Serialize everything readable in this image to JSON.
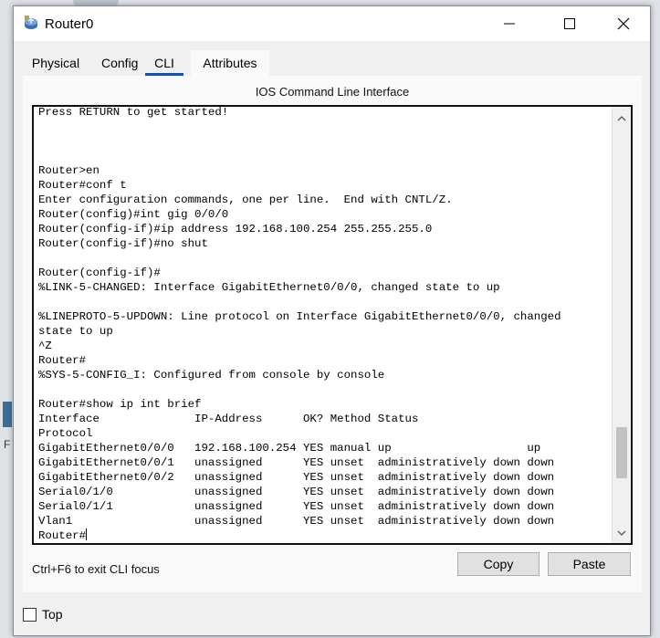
{
  "window": {
    "title": "Router0",
    "icon": "router-icon",
    "controls": [
      "minimize-icon",
      "maximize-icon",
      "close-icon"
    ]
  },
  "tabs": [
    {
      "label": "Physical"
    },
    {
      "label": "Config"
    },
    {
      "label": "CLI",
      "active": true
    },
    {
      "label": "Attributes"
    }
  ],
  "cli": {
    "header": "IOS Command Line Interface",
    "lines": [
      "Press RETURN to get started!",
      "",
      "",
      "",
      "Router>en",
      "Router#conf t",
      "Enter configuration commands, one per line.  End with CNTL/Z.",
      "Router(config)#int gig 0/0/0",
      "Router(config-if)#ip address 192.168.100.254 255.255.255.0",
      "Router(config-if)#no shut",
      "",
      "Router(config-if)#",
      "%LINK-5-CHANGED: Interface GigabitEthernet0/0/0, changed state to up",
      "",
      "%LINEPROTO-5-UPDOWN: Line protocol on Interface GigabitEthernet0/0/0, changed",
      "state to up",
      "^Z",
      "Router#",
      "%SYS-5-CONFIG_I: Configured from console by console",
      "",
      "Router#show ip int brief",
      "Interface              IP-Address      OK? Method Status",
      "Protocol",
      "GigabitEthernet0/0/0   192.168.100.254 YES manual up                    up",
      "GigabitEthernet0/0/1   unassigned      YES unset  administratively down down",
      "GigabitEthernet0/0/2   unassigned      YES unset  administratively down down",
      "Serial0/1/0            unassigned      YES unset  administratively down down",
      "Serial0/1/1            unassigned      YES unset  administratively down down",
      "Vlan1                  unassigned      YES unset  administratively down down"
    ],
    "prompt": "Router#",
    "scroll_position": 0.87
  },
  "footer": {
    "hint": "Ctrl+F6 to exit CLI focus",
    "copy_label": "Copy",
    "paste_label": "Paste",
    "top_label": "Top",
    "top_checked": false
  },
  "background": {
    "partial_label": "F"
  },
  "colors": {
    "accent": "#1e4fa8",
    "terminal_bg": "#ffffff",
    "window_bg": "#f0f0f0"
  }
}
